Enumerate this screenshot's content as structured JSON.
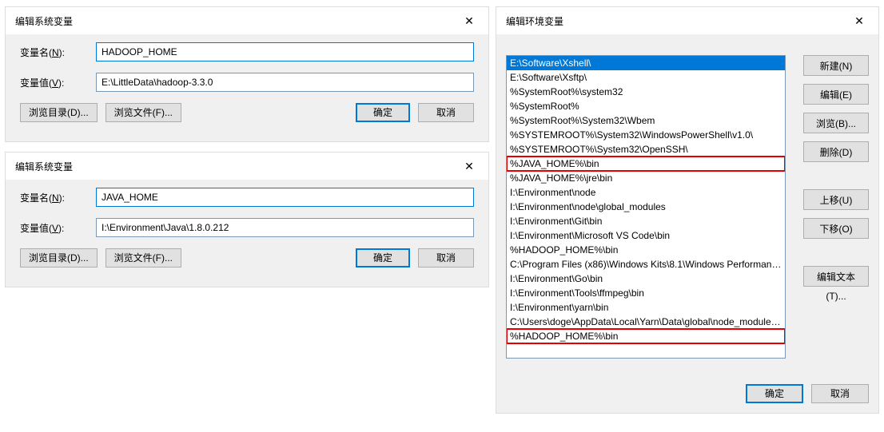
{
  "dialog1": {
    "title": "编辑系统变量",
    "name_label_pre": "变量名(",
    "name_label_u": "N",
    "name_label_post": "):",
    "name_value": "HADOOP_HOME",
    "value_label_pre": "变量值(",
    "value_label_u": "V",
    "value_label_post": "):",
    "value_value": "E:\\LittleData\\hadoop-3.3.0",
    "browse_dir": "浏览目录(D)...",
    "browse_file": "浏览文件(F)...",
    "ok": "确定",
    "cancel": "取消"
  },
  "dialog2": {
    "title": "编辑系统变量",
    "name_value": "JAVA_HOME",
    "value_value": "I:\\Environment\\Java\\1.8.0.212",
    "browse_dir": "浏览目录(D)...",
    "browse_file": "浏览文件(F)...",
    "ok": "确定",
    "cancel": "取消"
  },
  "dialog3": {
    "title": "编辑环境变量",
    "items": [
      "E:\\Software\\Xshell\\",
      "E:\\Software\\Xsftp\\",
      "%SystemRoot%\\system32",
      "%SystemRoot%",
      "%SystemRoot%\\System32\\Wbem",
      "%SYSTEMROOT%\\System32\\WindowsPowerShell\\v1.0\\",
      "%SYSTEMROOT%\\System32\\OpenSSH\\",
      "%JAVA_HOME%\\bin",
      "%JAVA_HOME%\\jre\\bin",
      "I:\\Environment\\node",
      "I:\\Environment\\node\\global_modules",
      "I:\\Environment\\Git\\bin",
      "I:\\Environment\\Microsoft VS Code\\bin",
      "%HADOOP_HOME%\\bin",
      "C:\\Program Files (x86)\\Windows Kits\\8.1\\Windows Performance...",
      "I:\\Environment\\Go\\bin",
      "I:\\Environment\\Tools\\ffmpeg\\bin",
      "I:\\Environment\\yarn\\bin",
      "C:\\Users\\doge\\AppData\\Local\\Yarn\\Data\\global\\node_modules...",
      "%HADOOP_HOME%\\bin"
    ],
    "selected_index": 0,
    "highlight_indices": [
      7,
      19
    ],
    "btn_new": "新建(N)",
    "btn_edit": "编辑(E)",
    "btn_browse": "浏览(B)...",
    "btn_delete": "删除(D)",
    "btn_moveup": "上移(U)",
    "btn_movedown": "下移(O)",
    "btn_edittext": "编辑文本(T)...",
    "ok": "确定",
    "cancel": "取消"
  }
}
